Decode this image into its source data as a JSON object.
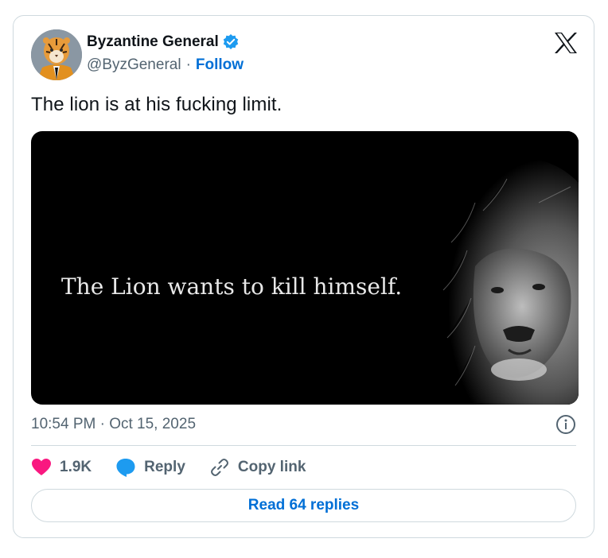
{
  "author": {
    "name": "Byzantine General",
    "handle": "@ByzGeneral",
    "separator": "·",
    "follow_label": "Follow",
    "verified": true,
    "avatar_icon": "tiger-avatar"
  },
  "platform_icon": "x-logo-icon",
  "tweet": {
    "text": "The lion is at his fucking limit.",
    "media": {
      "caption": "The Lion wants to kill himself.",
      "subject": "lion-portrait"
    },
    "timestamp": "10:54 PM · Oct 15, 2025"
  },
  "actions": {
    "like_count": "1.9K",
    "reply_label": "Reply",
    "copy_link_label": "Copy link"
  },
  "read_replies_label": "Read 64 replies",
  "colors": {
    "accent": "#006fd6",
    "like": "#f91880",
    "verified": "#1d9bf0",
    "muted": "#536471",
    "border": "#cfd9de"
  }
}
